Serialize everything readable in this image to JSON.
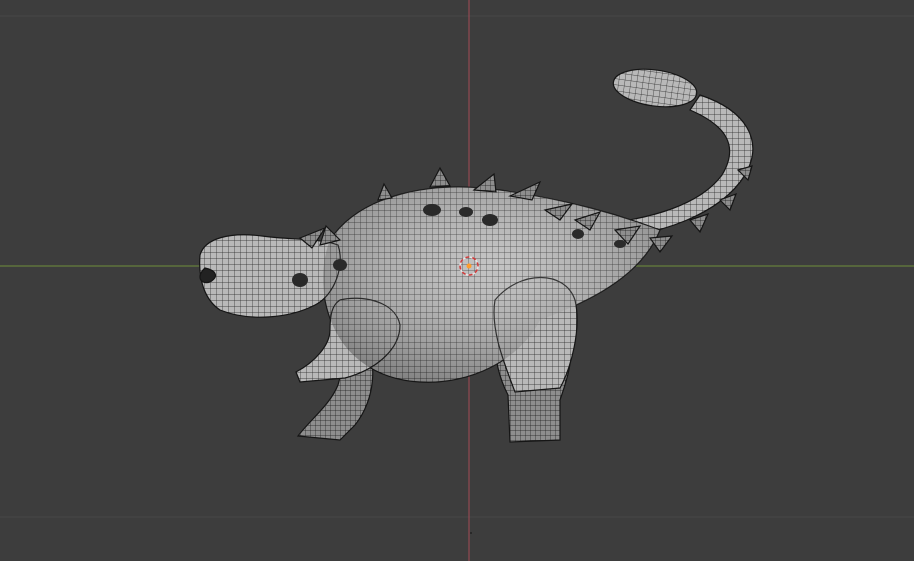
{
  "viewport": {
    "background": "#3d3d3d",
    "grid_line_color": "#4a4a4a",
    "x_axis_color": "#6f8f3a",
    "z_axis_color": "#a24a55"
  },
  "scene": {
    "object": "ankylosaurus-mesh",
    "display": "wireframe-on-shaded",
    "mesh_color": "#bdbdbd",
    "wire_color": "#1a1a1a",
    "origin_marker_color": "#ff9d2b"
  }
}
